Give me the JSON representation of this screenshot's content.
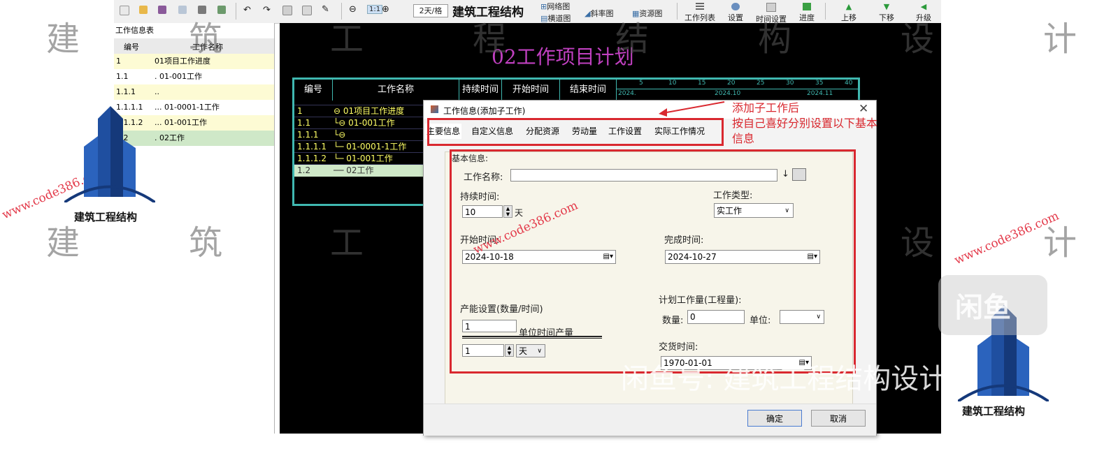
{
  "toolbar": {
    "scale_label": "2天/格",
    "zoom_label": "1:1",
    "brand_overlay": "建筑工程结构",
    "view_network": "网络图",
    "view_gantt": "横道图",
    "view_slope": "斜率图",
    "view_resource": "资源图",
    "btn_work_list": "工作列表",
    "btn_settings": "设置",
    "btn_time_settings": "时间设置",
    "btn_progress": "进度",
    "btn_move_up": "上移",
    "btn_move_down": "下移",
    "btn_upgrade": "升级"
  },
  "left_panel": {
    "title": "工作信息表",
    "headers": [
      "编号",
      "工作名称"
    ],
    "rows": [
      {
        "id": "1",
        "name": "01项目工作进度",
        "bg": "#fdfbd4"
      },
      {
        "id": "1.1",
        "name": ". 01-001工作",
        "bg": "#ffffff"
      },
      {
        "id": "1.1.1",
        "name": "..",
        "bg": "#fdfbd4"
      },
      {
        "id": "1.1.1.1",
        "name": "... 01-0001-1工作",
        "bg": "#ffffff"
      },
      {
        "id": "1.1.1.2",
        "name": "... 01-001工作",
        "bg": "#fdfbd4"
      },
      {
        "id": "1.2",
        "name": ". 02工作",
        "bg": "#cfe8c8"
      }
    ]
  },
  "gantt": {
    "title": "02工作项目计划",
    "headers": [
      "编号",
      "工作名称",
      "持续时间",
      "开始时间",
      "结束时间"
    ],
    "timeline_ticks": [
      "5",
      "10",
      "15",
      "20",
      "25",
      "30",
      "35",
      "40"
    ],
    "timeline_months": [
      "2024.",
      "2024.10",
      "2024.11"
    ],
    "rows": [
      {
        "id": "1",
        "name": "⊖ 01项目工作进度"
      },
      {
        "id": "1.1",
        "name": "└⊖ 01-001工作"
      },
      {
        "id": "1.1.1",
        "name": "└⊖"
      },
      {
        "id": "1.1.1.1",
        "name": "└─ 01-0001-1工作"
      },
      {
        "id": "1.1.1.2",
        "name": "└─ 01-001工作"
      },
      {
        "id": "1.2",
        "name": "── 02工作"
      }
    ]
  },
  "dialog": {
    "title": "工作信息(添加子工作)",
    "tabs": [
      "主要信息",
      "自定义信息",
      "分配资源",
      "劳动量",
      "工作设置",
      "实际工作情况"
    ],
    "basic_info_label": "基本信息:",
    "work_name_label": "工作名称:",
    "work_name_value": "",
    "duration_label": "持续时间:",
    "duration_value": "10",
    "duration_unit": "天",
    "work_type_label": "工作类型:",
    "work_type_value": "实工作",
    "start_label": "开始时间:",
    "start_value": "2024-10-18",
    "finish_label": "完成时间:",
    "finish_value": "2024-10-27",
    "capacity_label": "产能设置(数量/时间)",
    "capacity_value": "1",
    "capacity_unit_label": "单位时间产量",
    "period_value": "1",
    "period_unit": "天",
    "planned_label": "计划工作量(工程量):",
    "quantity_label": "数量:",
    "quantity_value": "0",
    "unit_label": "单位:",
    "unit_value": "",
    "delivery_label": "交货时间:",
    "delivery_value": "1970-01-01",
    "ok": "确定",
    "cancel": "取消"
  },
  "annotation": {
    "line1": "添加子工作后",
    "line2": "按自己喜好分别设置以下基本",
    "line3": "信息"
  },
  "watermarks": {
    "chars_row": [
      "建",
      "筑",
      "工",
      "程",
      "结",
      "构",
      "设",
      "计"
    ],
    "url": "www.code386.com",
    "logo_text": "建筑工程结构",
    "overlay_text": "闲鱼号: 建筑工程结构设计",
    "corner_badge": "闲鱼"
  },
  "colors": {
    "gantt_bg": "#000000",
    "gantt_frame": "#40b8b0",
    "gantt_title": "#c040c0",
    "annotation_red": "#d9282f",
    "row_yellow": "#fdfbd4",
    "row_green": "#cfe8c8"
  }
}
